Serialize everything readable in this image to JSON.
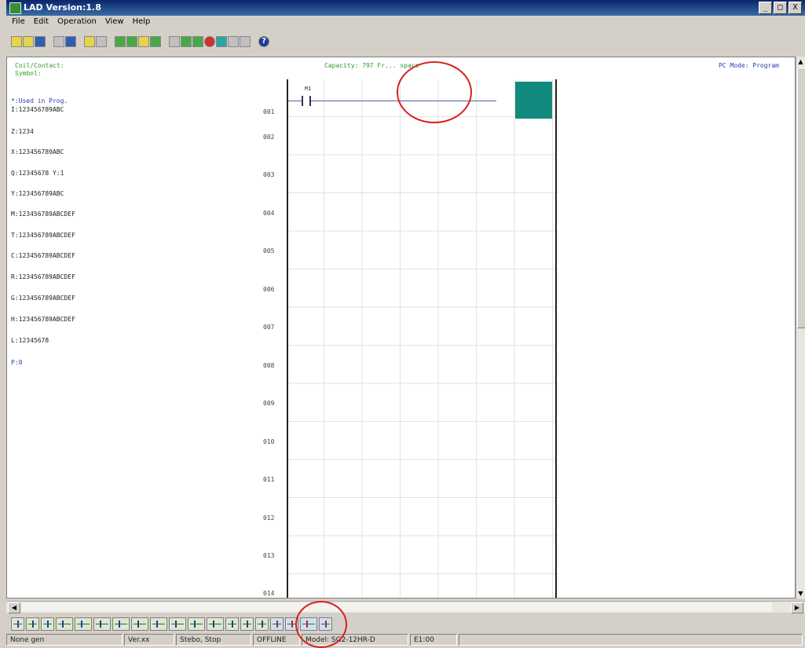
{
  "window": {
    "title": "LAD Version:1.8",
    "min": "_",
    "max": "□",
    "close": "X"
  },
  "menu": [
    "File",
    "Edit",
    "Operation",
    "View",
    "Help"
  ],
  "header": {
    "left_line1": "Coil/Contact:",
    "left_line2": "Symbol:",
    "capacity": "Capacity: 797 Fr... space",
    "mode": "PC Mode: Program"
  },
  "symbols": [
    {
      "text": "*:Used in Prog.",
      "color": "blue"
    },
    {
      "text": "I:123456789ABC",
      "color": "dark"
    },
    {
      "text": "Z:1234",
      "color": "dark"
    },
    {
      "text": "X:123456789ABC",
      "color": "dark"
    },
    {
      "text": "Q:12345678 Y:1",
      "color": "dark"
    },
    {
      "text": "Y:123456789ABC",
      "color": "dark"
    },
    {
      "text": "M:123456789ABCDEF",
      "color": "dark"
    },
    {
      "text": "T:123456789ABCDEF",
      "color": "dark"
    },
    {
      "text": "C:123456789ABCDEF",
      "color": "dark"
    },
    {
      "text": "R:123456789ABCDEF",
      "color": "dark"
    },
    {
      "text": "G:123456789ABCDEF",
      "color": "dark"
    },
    {
      "text": "H:123456789ABCDEF",
      "color": "dark"
    },
    {
      "text": "L:12345678",
      "color": "dark"
    },
    {
      "text": "P:0",
      "color": "blue"
    }
  ],
  "rungs": [
    "001",
    "002",
    "003",
    "004",
    "005",
    "006",
    "007",
    "008",
    "009",
    "010",
    "011",
    "012",
    "013",
    "014"
  ],
  "contact": {
    "label": "M1"
  },
  "status": {
    "hint": "None gen",
    "version": "Ver.xx",
    "state": "Stebo, Stop",
    "connection": "OFFLINE",
    "model": "Model: SG2-12HR-D",
    "time": "E1:00"
  },
  "colors": {
    "cursor": "#138a7e",
    "annotation": "#d82020",
    "titlebar": "#0a246a"
  }
}
